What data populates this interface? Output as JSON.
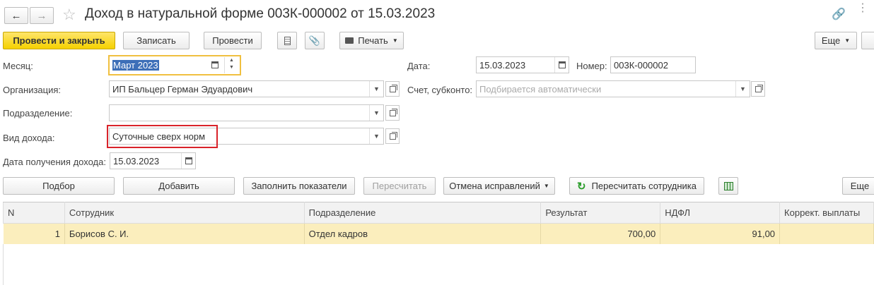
{
  "window": {
    "title": "Доход в натуральной форме 003К-000002 от 15.03.2023"
  },
  "toolbar": {
    "post_close": "Провести и закрыть",
    "save": "Записать",
    "post": "Провести",
    "print": "Печать",
    "more": "Еще"
  },
  "form": {
    "month_label": "Месяц:",
    "month_value": "Март 2023",
    "date_label": "Дата:",
    "date_value": "15.03.2023",
    "number_label": "Номер:",
    "number_value": "003К-000002",
    "org_label": "Организация:",
    "org_value": "ИП Бальцер Герман Эдуардович",
    "account_label": "Счет, субконто:",
    "account_placeholder": "Подбирается автоматически",
    "division_label": "Подразделение:",
    "division_value": "",
    "income_type_label": "Вид дохода:",
    "income_type_value": "Суточные сверх норм",
    "income_date_label": "Дата получения дохода:",
    "income_date_value": "15.03.2023"
  },
  "table_toolbar": {
    "pick": "Подбор",
    "add": "Добавить",
    "fill": "Заполнить показатели",
    "recalc": "Пересчитать",
    "cancel_fix": "Отмена исправлений",
    "recalc_employee": "Пересчитать сотрудника",
    "more": "Еще"
  },
  "table": {
    "columns": [
      "N",
      "Сотрудник",
      "Подразделение",
      "Результат",
      "НДФЛ",
      "Коррект. выплаты"
    ],
    "rows": [
      {
        "n": "1",
        "employee": "Борисов С. И.",
        "division": "Отдел кадров",
        "result": "700,00",
        "ndfl": "91,00",
        "correction": ""
      }
    ]
  },
  "colors": {
    "primary_button": "#f5d100",
    "selected_row": "#fbeebd",
    "highlight_border": "#d9232a",
    "focus_border": "#f0c040"
  },
  "icons": [
    "back-arrow-icon",
    "forward-arrow-icon",
    "star-icon",
    "link-icon",
    "kebab-menu-icon",
    "document-list-icon",
    "paperclip-icon",
    "printer-icon",
    "calendar-icon",
    "refresh-icon",
    "excel-icon",
    "open-form-icon"
  ]
}
